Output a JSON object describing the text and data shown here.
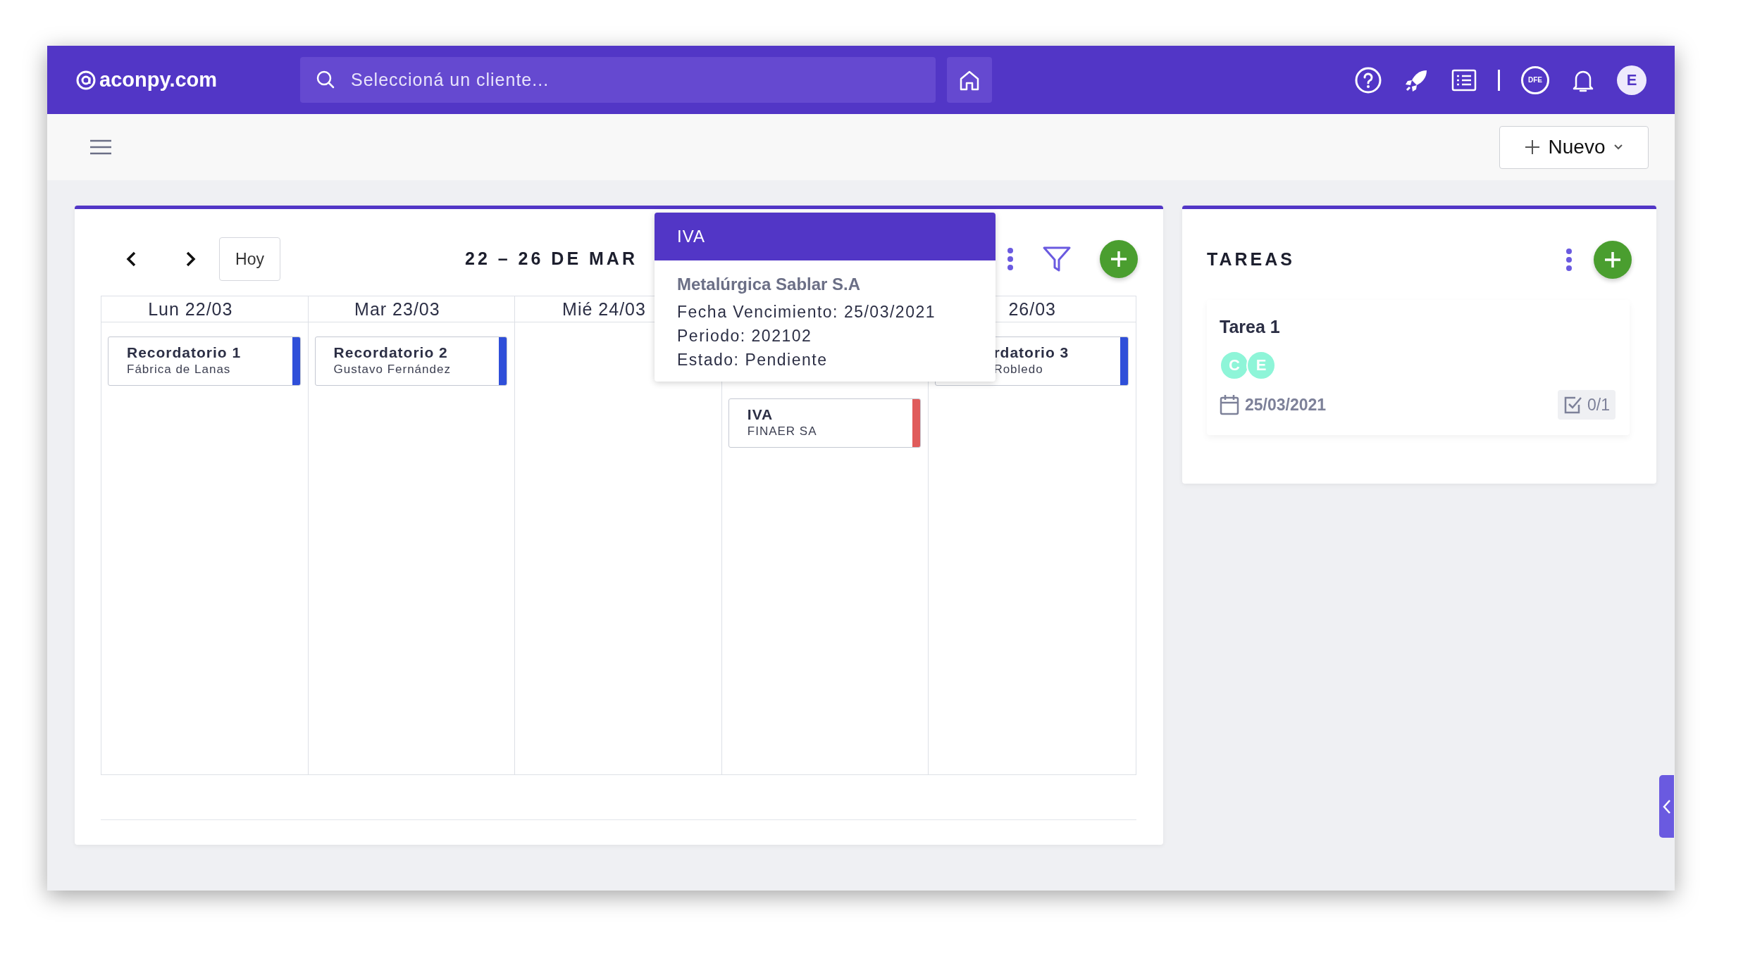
{
  "topbar": {
    "logo": "aconpy.com",
    "search": {
      "placeholder": "Seleccioná un cliente..."
    },
    "dfe_badge": "DFE",
    "avatar": "E"
  },
  "toolbar": {
    "new_button": "Nuevo"
  },
  "calendar": {
    "today_button": "Hoy",
    "title": "22 – 26 DE MAR",
    "days": [
      {
        "label": "Lun 22/03",
        "events": [
          {
            "title": "Recordatorio 1",
            "subtitle": "Fábrica de Lanas",
            "color": "#2f4fd9"
          }
        ]
      },
      {
        "label": "Mar 23/03",
        "events": [
          {
            "title": "Recordatorio 2",
            "subtitle": "Gustavo Fernández",
            "color": "#2f4fd9"
          }
        ]
      },
      {
        "label": "Mié 24/03"
      },
      {
        "events": [
          {
            "title": "IVA",
            "subtitle": "FINAER SA",
            "color": "#e05b5b"
          }
        ]
      },
      {
        "label": "26/03",
        "events": [
          {
            "title": "rdatorio 3",
            "subtitle": "Robledo",
            "color": "#2f4fd9"
          }
        ]
      }
    ],
    "tooltip": {
      "title": "IVA",
      "client": "Metalúrgica Sablar S.A",
      "lines": [
        "Fecha Vencimiento: 25/03/2021",
        "Periodo: 202102",
        "Estado: Pendiente"
      ]
    }
  },
  "tasks": {
    "title": "TAREAS",
    "items": [
      {
        "title": "Tarea 1",
        "assignees": [
          "C",
          "E"
        ],
        "due": "25/03/2021",
        "checklist": "0/1"
      }
    ]
  }
}
